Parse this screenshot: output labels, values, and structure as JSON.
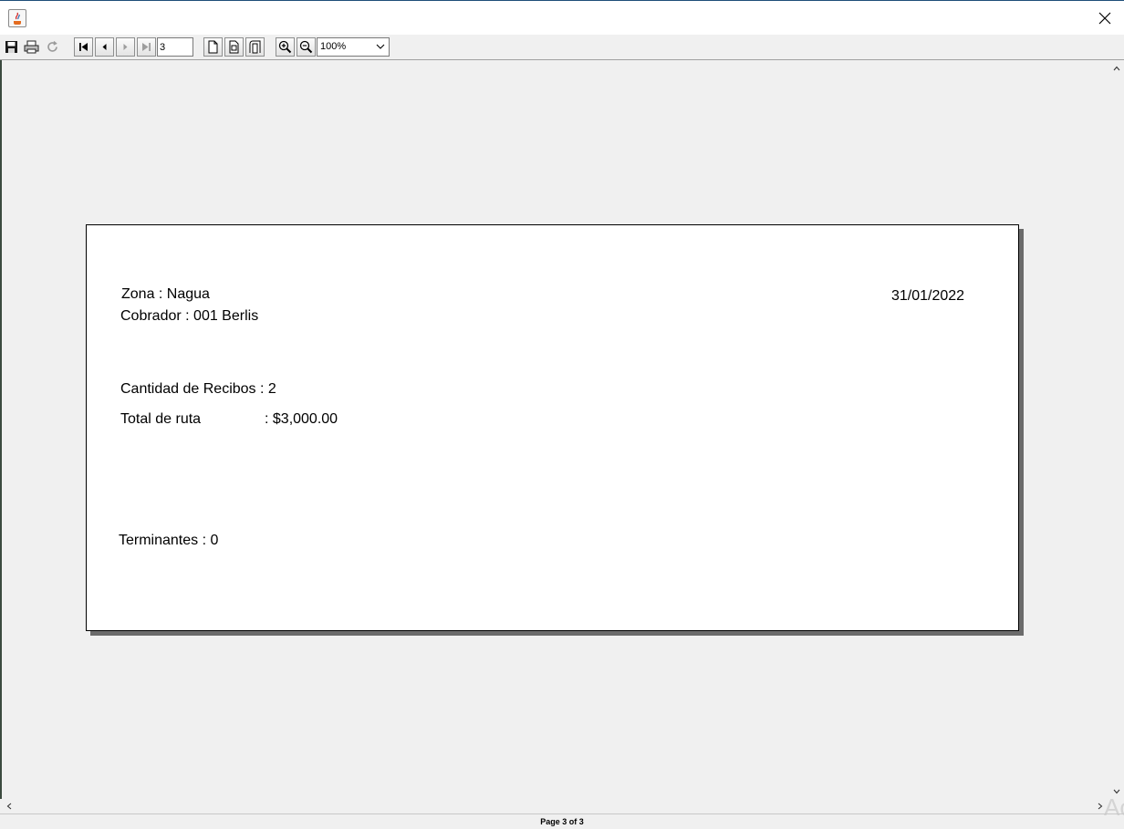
{
  "window": {
    "app_icon": "java-coffee-icon"
  },
  "toolbar": {
    "buttons": [
      {
        "name": "save-button",
        "icon": "floppy-disk-icon"
      },
      {
        "name": "print-button",
        "icon": "printer-icon"
      },
      {
        "name": "reload-button",
        "icon": "refresh-icon"
      },
      {
        "name": "first-page-button",
        "icon": "first-page-icon"
      },
      {
        "name": "previous-page-button",
        "icon": "previous-page-icon"
      },
      {
        "name": "next-page-button",
        "icon": "next-page-icon"
      },
      {
        "name": "last-page-button",
        "icon": "last-page-icon"
      },
      {
        "name": "actual-size-button",
        "icon": "page-icon"
      },
      {
        "name": "fit-page-button",
        "icon": "fit-page-icon"
      },
      {
        "name": "fit-width-button",
        "icon": "fit-width-icon"
      },
      {
        "name": "zoom-in-button",
        "icon": "zoom-in-icon"
      },
      {
        "name": "zoom-out-button",
        "icon": "zoom-out-icon"
      }
    ],
    "page_input_value": "3",
    "zoom_value": "100%"
  },
  "report": {
    "zona": "Zona : Nagua",
    "cobrador": "Cobrador : 001 Berlis",
    "fecha": "31/01/2022",
    "cantidad_recibos": "Cantidad de Recibos : 2",
    "total_label": "Total de ruta",
    "total_value": ": $3,000.00",
    "terminantes": "Terminantes : 0"
  },
  "status": {
    "page_info": "Page 3 of 3"
  },
  "watermark": {
    "text": "Ac"
  }
}
